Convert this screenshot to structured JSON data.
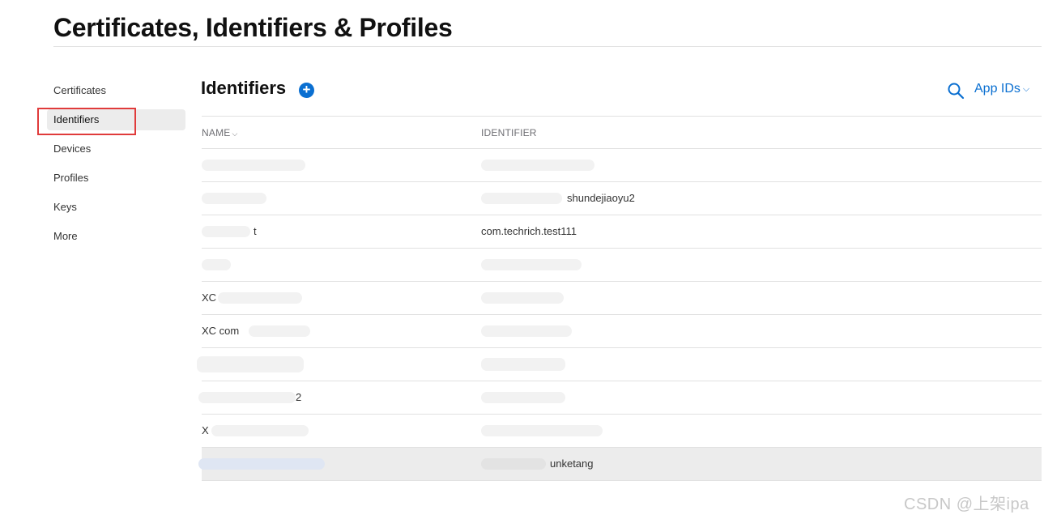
{
  "page": {
    "title": "Certificates, Identifiers & Profiles"
  },
  "sidebar": {
    "items": [
      {
        "label": "Certificates"
      },
      {
        "label": "Identifiers"
      },
      {
        "label": "Devices"
      },
      {
        "label": "Profiles"
      },
      {
        "label": "Keys"
      },
      {
        "label": "More"
      }
    ]
  },
  "section": {
    "title": "Identifiers",
    "add_icon": "plus-circle-icon",
    "search_icon": "search-icon",
    "filter_label": "App IDs"
  },
  "table": {
    "columns": {
      "name": "NAME",
      "identifier": "IDENTIFIER"
    },
    "rows": [
      {
        "name": "",
        "identifier": ""
      },
      {
        "name": "",
        "identifier": "shundejiaoyu2"
      },
      {
        "name": "t",
        "identifier": "com.techrich.test111"
      },
      {
        "name": "",
        "identifier": ""
      },
      {
        "name": "XC",
        "identifier": ""
      },
      {
        "name": "XC com",
        "identifier": ""
      },
      {
        "name": "",
        "identifier": ""
      },
      {
        "name": "2",
        "identifier": ""
      },
      {
        "name": "X",
        "identifier": ""
      },
      {
        "name": "",
        "identifier": "unketang"
      }
    ]
  },
  "watermark": {
    "text": "CSDN @上架ipa"
  },
  "colors": {
    "accent": "#0a6fd1",
    "highlight": "#e03b3b"
  }
}
